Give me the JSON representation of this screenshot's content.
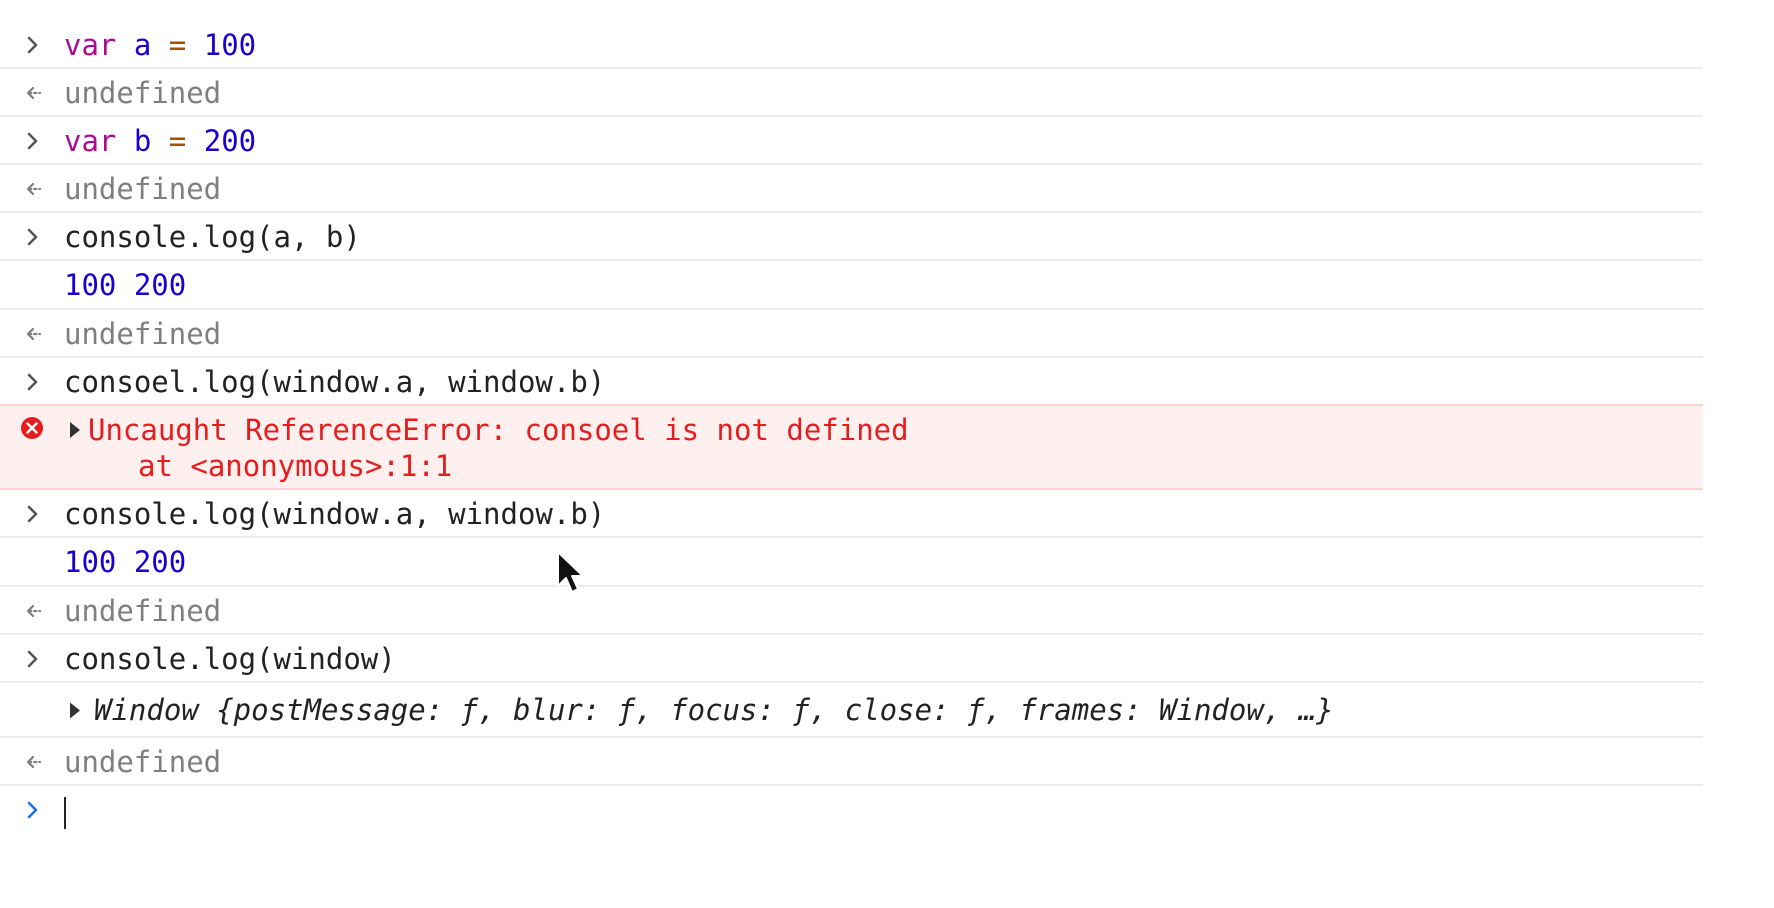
{
  "console": {
    "entries": [
      {
        "type": "input",
        "tokens": [
          {
            "c": "kw",
            "t": "var"
          },
          {
            "c": "plain",
            "t": " "
          },
          {
            "c": "id",
            "t": "a"
          },
          {
            "c": "plain",
            "t": " "
          },
          {
            "c": "op",
            "t": "="
          },
          {
            "c": "plain",
            "t": " "
          },
          {
            "c": "num",
            "t": "100"
          }
        ]
      },
      {
        "type": "result",
        "text": "undefined"
      },
      {
        "type": "input",
        "tokens": [
          {
            "c": "kw",
            "t": "var"
          },
          {
            "c": "plain",
            "t": " "
          },
          {
            "c": "id",
            "t": "b"
          },
          {
            "c": "plain",
            "t": " "
          },
          {
            "c": "op",
            "t": "="
          },
          {
            "c": "plain",
            "t": " "
          },
          {
            "c": "num",
            "t": "200"
          }
        ]
      },
      {
        "type": "result",
        "text": "undefined"
      },
      {
        "type": "input",
        "tokens": [
          {
            "c": "plain",
            "t": "console.log(a, b)"
          }
        ]
      },
      {
        "type": "log",
        "text": "100 200"
      },
      {
        "type": "result",
        "text": "undefined"
      },
      {
        "type": "input",
        "tokens": [
          {
            "c": "plain",
            "t": "consoel.log(window.a, window.b)"
          }
        ]
      },
      {
        "type": "error",
        "line1": "Uncaught ReferenceError: consoel is not defined",
        "line2": "at <anonymous>:1:1"
      },
      {
        "type": "input",
        "tokens": [
          {
            "c": "plain",
            "t": "console.log(window.a, window.b)"
          }
        ]
      },
      {
        "type": "log",
        "text": "100 200"
      },
      {
        "type": "result",
        "text": "undefined"
      },
      {
        "type": "input",
        "tokens": [
          {
            "c": "plain",
            "t": "console.log(window)"
          }
        ]
      },
      {
        "type": "object",
        "text": "Window {postMessage: ƒ, blur: ƒ, focus: ƒ, close: ƒ, frames: Window, …}"
      },
      {
        "type": "result",
        "text": "undefined"
      },
      {
        "type": "prompt",
        "text": ""
      }
    ]
  },
  "colors": {
    "prompt_active": "#1a73e8",
    "marker_gray": "#7f7f7f",
    "error_red": "#e71d1d",
    "error_bg": "#fff0f0"
  },
  "icons": {
    "input": "chevron-right-icon",
    "result": "return-arrow-icon",
    "error": "error-circle-icon",
    "disclosure": "triangle-right-icon",
    "cursor": "mouse-pointer-icon"
  }
}
